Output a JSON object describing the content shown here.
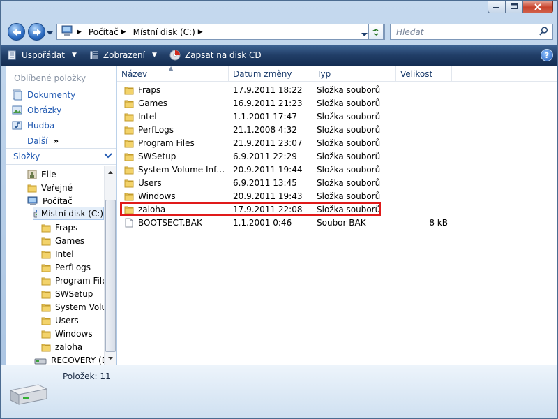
{
  "window": {
    "caption_buttons": [
      "minimize-icon",
      "maximize-icon",
      "close-icon"
    ]
  },
  "address": {
    "crumbs": [
      "Počítač",
      "Místní disk (C:)"
    ],
    "search_placeholder": "Hledat"
  },
  "toolbar": {
    "organize_label": "Uspořádat",
    "views_label": "Zobrazení",
    "burn_label": "Zapsat na disk CD"
  },
  "favorites": {
    "header": "Oblíbené položky",
    "items": [
      {
        "label": "Dokumenty",
        "icon": "documents-icon"
      },
      {
        "label": "Obrázky",
        "icon": "pictures-icon"
      },
      {
        "label": "Hudba",
        "icon": "music-icon"
      }
    ],
    "more_label": "Další",
    "more_symbol": "»"
  },
  "folders": {
    "header": "Složky",
    "tree": [
      {
        "label": "Elle",
        "icon": "user-folder-icon"
      },
      {
        "label": "Veřejné",
        "icon": "folder-icon"
      },
      {
        "label": "Počítač",
        "icon": "computer-icon"
      },
      {
        "label": "Místní disk (C:)",
        "icon": "drive-icon",
        "selected": true
      },
      {
        "label": "Fraps",
        "icon": "folder-icon"
      },
      {
        "label": "Games",
        "icon": "folder-icon"
      },
      {
        "label": "Intel",
        "icon": "folder-icon"
      },
      {
        "label": "PerfLogs",
        "icon": "folder-icon"
      },
      {
        "label": "Program Files",
        "icon": "folder-icon"
      },
      {
        "label": "SWSetup",
        "icon": "folder-icon"
      },
      {
        "label": "System Volume Information",
        "icon": "folder-icon"
      },
      {
        "label": "Users",
        "icon": "folder-icon"
      },
      {
        "label": "Windows",
        "icon": "folder-icon"
      },
      {
        "label": "zaloha",
        "icon": "folder-icon"
      },
      {
        "label": "RECOVERY (D:)",
        "icon": "drive-icon"
      }
    ]
  },
  "files": {
    "columns": [
      "Název",
      "Datum změny",
      "Typ",
      "Velikost"
    ],
    "rows": [
      {
        "name": "Fraps",
        "date": "17.9.2011 18:22",
        "type": "Složka souborů",
        "size": "",
        "icon": "folder-icon"
      },
      {
        "name": "Games",
        "date": "16.9.2011 21:23",
        "type": "Složka souborů",
        "size": "",
        "icon": "folder-icon"
      },
      {
        "name": "Intel",
        "date": "1.1.2001 17:47",
        "type": "Složka souborů",
        "size": "",
        "icon": "folder-icon"
      },
      {
        "name": "PerfLogs",
        "date": "21.1.2008 4:32",
        "type": "Složka souborů",
        "size": "",
        "icon": "folder-icon"
      },
      {
        "name": "Program Files",
        "date": "21.9.2011 23:07",
        "type": "Složka souborů",
        "size": "",
        "icon": "folder-icon"
      },
      {
        "name": "SWSetup",
        "date": "6.9.2011 22:29",
        "type": "Složka souborů",
        "size": "",
        "icon": "folder-icon"
      },
      {
        "name": "System Volume Information",
        "date": "20.9.2011 19:44",
        "type": "Složka souborů",
        "size": "",
        "icon": "folder-icon"
      },
      {
        "name": "Users",
        "date": "6.9.2011 13:45",
        "type": "Složka souborů",
        "size": "",
        "icon": "folder-icon"
      },
      {
        "name": "Windows",
        "date": "20.9.2011 19:43",
        "type": "Složka souborů",
        "size": "",
        "icon": "folder-icon"
      },
      {
        "name": "zaloha",
        "date": "17.9.2011 22:08",
        "type": "Složka souborů",
        "size": "",
        "icon": "folder-icon",
        "highlighted": true
      },
      {
        "name": "BOOTSECT.BAK",
        "date": "1.1.2001 0:46",
        "type": "Soubor BAK",
        "size": "8 kB",
        "icon": "file-icon"
      }
    ],
    "highlight_color": "#e01a1a"
  },
  "details": {
    "count_label": "Položek: 11",
    "icon": "drive-icon"
  }
}
